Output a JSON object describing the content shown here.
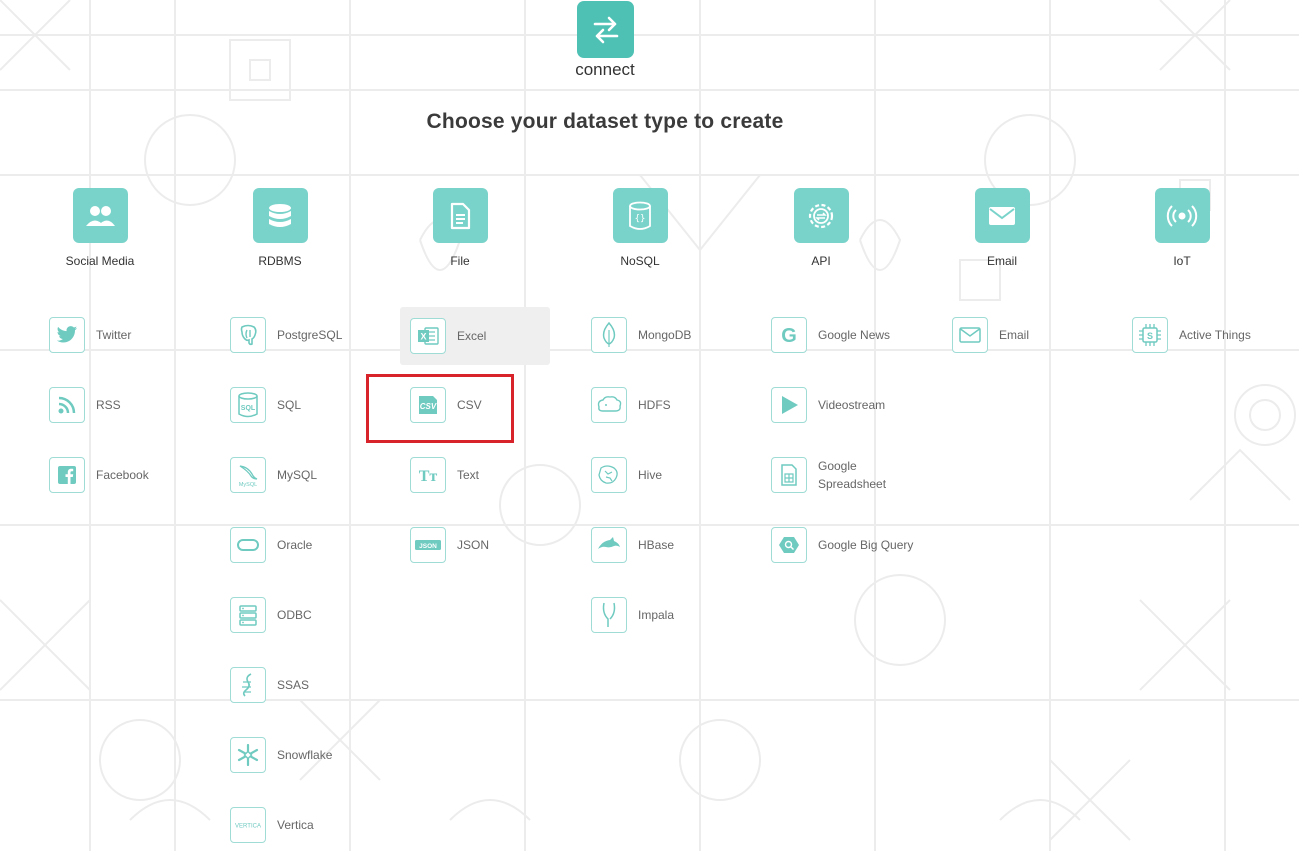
{
  "app": {
    "name": "connect"
  },
  "heading": "Choose your dataset type to create",
  "colors": {
    "accent": "#4fc1b4",
    "category_bg": "#7ad3ca",
    "item_border": "#9fdcd5",
    "highlight": "#d9232a"
  },
  "categories": [
    {
      "label": "Social Media",
      "icon": "users-icon"
    },
    {
      "label": "RDBMS",
      "icon": "database-icon"
    },
    {
      "label": "File",
      "icon": "file-icon"
    },
    {
      "label": "NoSQL",
      "icon": "nosql-icon"
    },
    {
      "label": "API",
      "icon": "api-gear-icon"
    },
    {
      "label": "Email",
      "icon": "envelope-icon"
    },
    {
      "label": "IoT",
      "icon": "broadcast-icon"
    }
  ],
  "items": {
    "social": [
      {
        "label": "Twitter",
        "icon": "twitter-icon"
      },
      {
        "label": "RSS",
        "icon": "rss-icon"
      },
      {
        "label": "Facebook",
        "icon": "facebook-icon"
      }
    ],
    "rdbms": [
      {
        "label": "PostgreSQL",
        "icon": "postgresql-icon"
      },
      {
        "label": "SQL",
        "icon": "sql-icon",
        "icon_text": "SQL"
      },
      {
        "label": "MySQL",
        "icon": "mysql-icon",
        "icon_text": "MySQL"
      },
      {
        "label": "Oracle",
        "icon": "oracle-icon"
      },
      {
        "label": "ODBC",
        "icon": "odbc-icon"
      },
      {
        "label": "SSAS",
        "icon": "ssas-icon"
      },
      {
        "label": "Snowflake",
        "icon": "snowflake-icon"
      },
      {
        "label": "Vertica",
        "icon": "vertica-icon",
        "icon_text": "VERTICA"
      }
    ],
    "file": [
      {
        "label": "Excel",
        "icon": "excel-icon",
        "icon_text": "X"
      },
      {
        "label": "CSV",
        "icon": "csv-icon",
        "icon_text": "CSV"
      },
      {
        "label": "Text",
        "icon": "text-icon",
        "icon_text": "Tт"
      },
      {
        "label": "JSON",
        "icon": "json-icon",
        "icon_text": "JSON"
      }
    ],
    "nosql": [
      {
        "label": "MongoDB",
        "icon": "mongodb-icon"
      },
      {
        "label": "HDFS",
        "icon": "hdfs-icon"
      },
      {
        "label": "Hive",
        "icon": "hive-icon"
      },
      {
        "label": "HBase",
        "icon": "hbase-icon"
      },
      {
        "label": "Impala",
        "icon": "impala-icon"
      }
    ],
    "api": [
      {
        "label": "Google News",
        "icon": "google-icon",
        "icon_text": "G"
      },
      {
        "label": "Videostream",
        "icon": "play-icon"
      },
      {
        "label": "Google Spreadsheet",
        "icon": "spreadsheet-icon"
      },
      {
        "label": "Google Big Query",
        "icon": "bigquery-icon"
      }
    ],
    "email": [
      {
        "label": "Email",
        "icon": "envelope-outline-icon"
      }
    ],
    "iot": [
      {
        "label": "Active Things",
        "icon": "chip-icon",
        "icon_text": "S"
      }
    ]
  },
  "selected_item": "Excel",
  "highlighted_item": "CSV"
}
